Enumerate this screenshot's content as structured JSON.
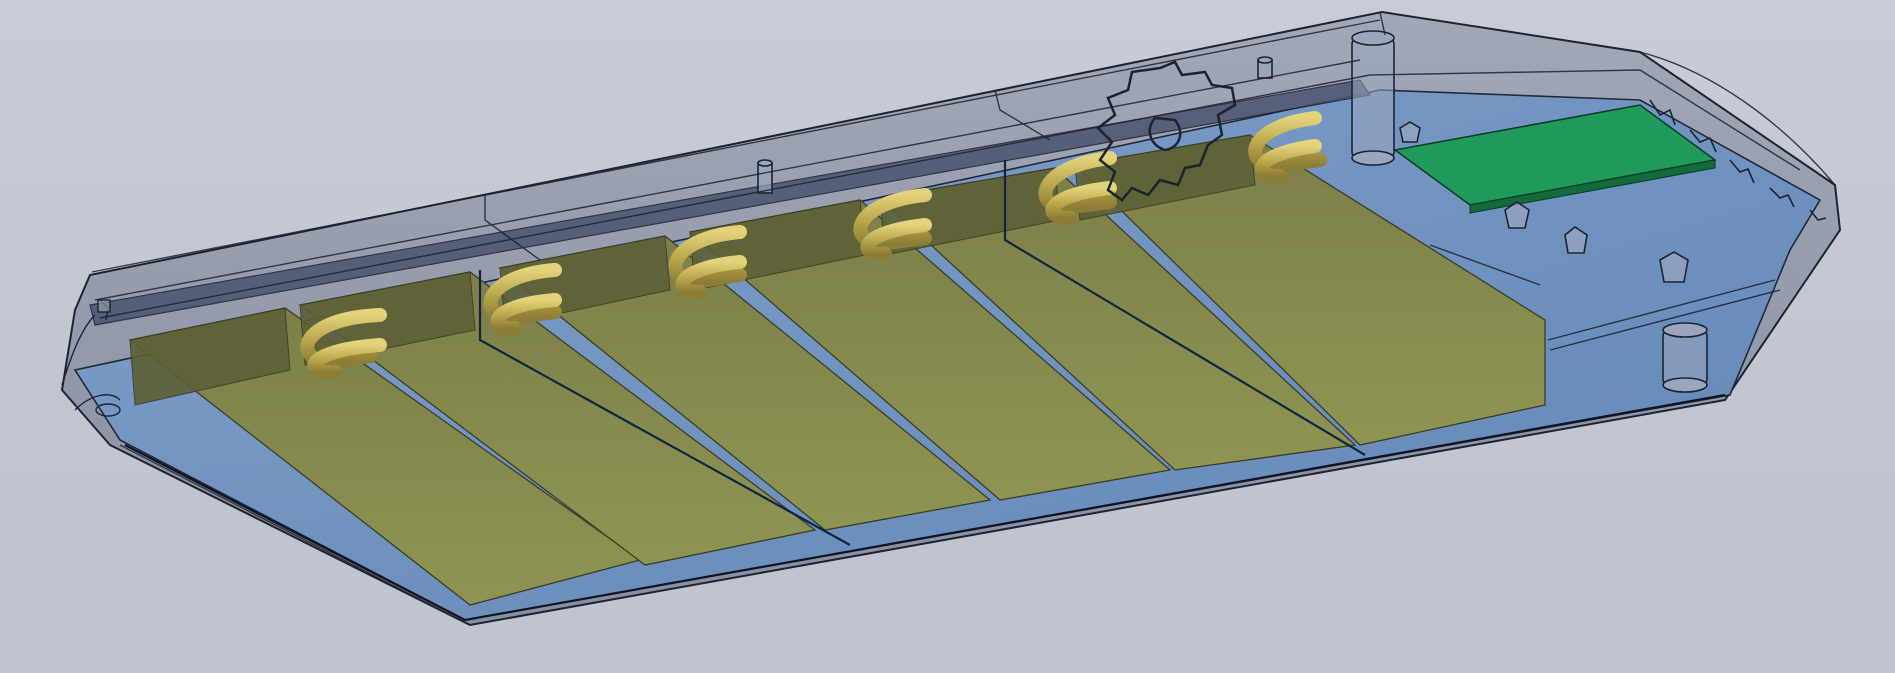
{
  "viewport": {
    "background": "#c4c8d2",
    "visible_text": []
  },
  "model": {
    "description_key": "cad-assembly",
    "colors": {
      "housing_shell": "#8f97a8",
      "housing_outline": "#1d2330",
      "inner_tray": "#6f93c4",
      "battery_cell": "#8d8f50",
      "battery_cell_light": "#a3a35e",
      "cell_tube": "#c8b85a",
      "circuit_board": "#1f9a5a"
    },
    "battery_cell_count": 6,
    "cable_loop_count": 6,
    "mounting_boss_count": 8
  }
}
